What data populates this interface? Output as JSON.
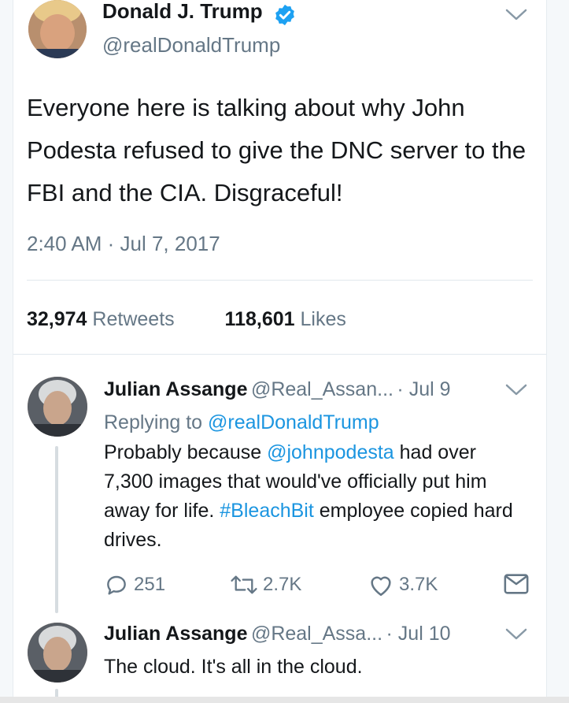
{
  "main_tweet": {
    "author_name": "Donald J. Trump",
    "author_handle": "@realDonaldTrump",
    "text": "Everyone here is talking about why John Podesta refused to give the DNC server to the FBI and the CIA. Disgraceful!",
    "timestamp": "2:40 AM · Jul 7, 2017",
    "retweets_count": "32,974",
    "retweets_label": "Retweets",
    "likes_count": "118,601",
    "likes_label": "Likes"
  },
  "reply1": {
    "author_name": "Julian Assange",
    "author_handle": "@Real_Assan...",
    "date": "· Jul 9",
    "replying_prefix": "Replying to",
    "replying_handle": "@realDonaldTrump",
    "text_part1": "Probably because ",
    "mention": "@johnpodesta",
    "text_part2": " had over 7,300 images that would've officially put him away for life. ",
    "hashtag": "#BleachBit",
    "text_part3": " employee copied hard drives.",
    "replies": "251",
    "retweets": "2.7K",
    "likes": "3.7K"
  },
  "reply2": {
    "author_name": "Julian Assange",
    "author_handle": "@Real_Assa...",
    "date": "· Jul 10",
    "text": "The cloud. It's all in the cloud."
  },
  "colors": {
    "accent": "#1b95e0",
    "muted": "#657786",
    "text": "#14171a",
    "verified": "#1da1f2"
  },
  "icons": [
    "verified-badge-icon",
    "chevron-down-icon",
    "reply-icon",
    "retweet-icon",
    "like-icon",
    "direct-message-icon"
  ]
}
